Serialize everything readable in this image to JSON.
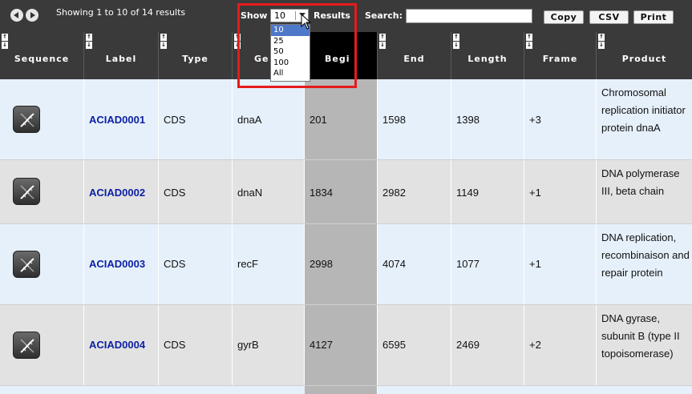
{
  "toolbar": {
    "info": "Showing 1 to 10 of 14 results",
    "show_label": "Show",
    "page_size": "10",
    "results_label": "Results",
    "search_label": "Search:",
    "search_value": "",
    "copy_label": "Copy",
    "csv_label": "CSV",
    "print_label": "Print"
  },
  "dropdown": {
    "options": [
      "10",
      "25",
      "50",
      "100",
      "All"
    ],
    "selected": "10"
  },
  "columns": [
    "Sequence",
    "Label",
    "Type",
    "Gene",
    "Begin",
    "End",
    "Length",
    "Frame",
    "Product"
  ],
  "visible_column_labels": [
    "Sequence",
    "Label",
    "Type",
    "Ge",
    "Begi",
    "End",
    "Length",
    "Frame",
    "Product"
  ],
  "rows": [
    {
      "label": "ACIAD0001",
      "type": "CDS",
      "gene": "dnaA",
      "begin": "201",
      "end": "1598",
      "length": "1398",
      "frame": "+3",
      "product": "Chromosomal replication initiator protein dnaA"
    },
    {
      "label": "ACIAD0002",
      "type": "CDS",
      "gene": "dnaN",
      "begin": "1834",
      "end": "2982",
      "length": "1149",
      "frame": "+1",
      "product": "DNA polymerase III, beta chain"
    },
    {
      "label": "ACIAD0003",
      "type": "CDS",
      "gene": "recF",
      "begin": "2998",
      "end": "4074",
      "length": "1077",
      "frame": "+1",
      "product": "DNA replication, recombinaison and repair protein"
    },
    {
      "label": "ACIAD0004",
      "type": "CDS",
      "gene": "gyrB",
      "begin": "4127",
      "end": "6595",
      "length": "2469",
      "frame": "+2",
      "product": "DNA gyrase, subunit B (type II topoisomerase)"
    }
  ],
  "icons": {
    "sequence": "dna-icon",
    "prev": "prev-arrow-icon",
    "next": "next-arrow-icon",
    "sort": "sort-arrows-icon"
  },
  "colors": {
    "toolbar_bg": "#3a3a3a",
    "row_odd": "#e6f0fb",
    "row_even": "#e2e2e2",
    "sorted_column": "#b6b6b6",
    "label_link": "#0b1fa4",
    "highlight": "#e51b1b",
    "dropdown_selected": "#4e78c8"
  }
}
